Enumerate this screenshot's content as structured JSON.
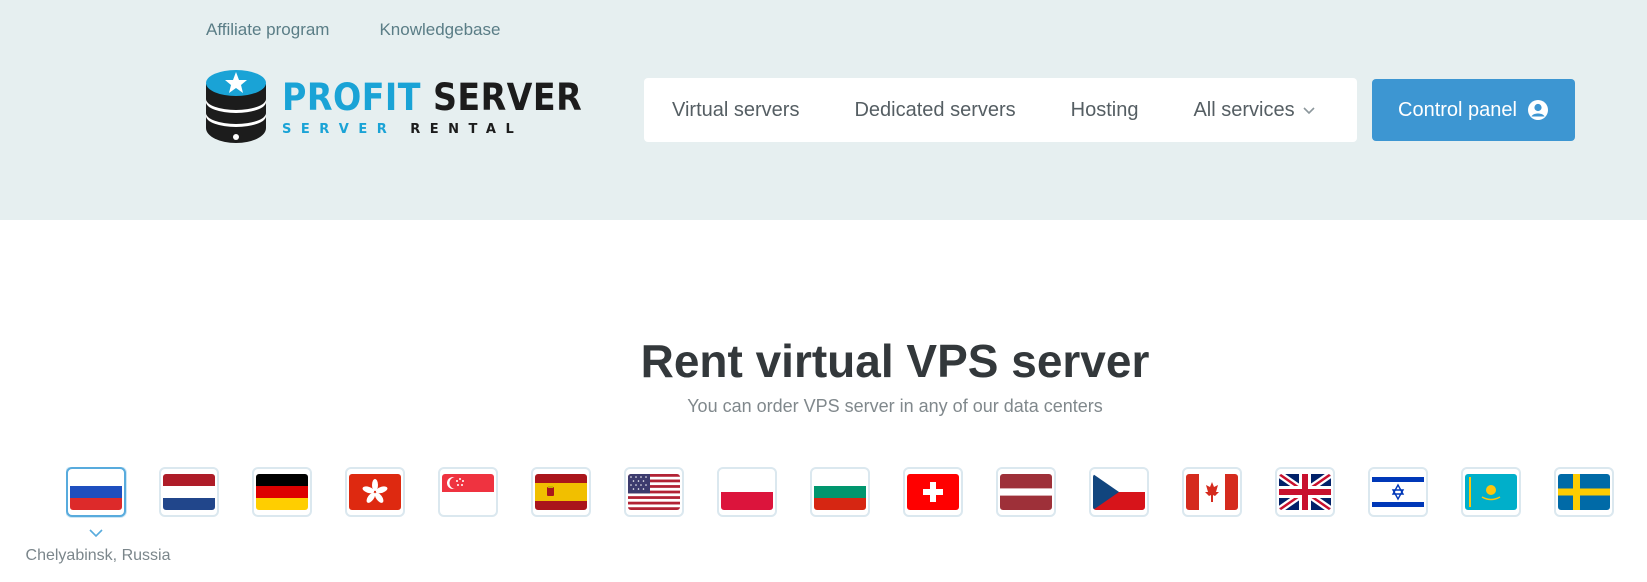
{
  "top_links": [
    "Affiliate program",
    "Knowledgebase"
  ],
  "logo": {
    "title_a": "PROFIT",
    "title_b": "SERVER",
    "sub_a": "SERVER",
    "sub_b": "RENTAL"
  },
  "nav": {
    "items": [
      "Virtual servers",
      "Dedicated servers",
      "Hosting",
      "All services"
    ],
    "control_panel": "Control panel"
  },
  "hero": {
    "title": "Rent virtual VPS server",
    "subtitle": "You can order VPS server in any of our data centers"
  },
  "locations": {
    "selected_label": "Chelyabinsk, Russia",
    "flags": [
      "russia-flag-icon",
      "netherlands-flag-icon",
      "germany-flag-icon",
      "hong-kong-flag-icon",
      "singapore-flag-icon",
      "spain-flag-icon",
      "usa-flag-icon",
      "poland-flag-icon",
      "bulgaria-flag-icon",
      "switzerland-flag-icon",
      "latvia-flag-icon",
      "czech-flag-icon",
      "canada-flag-icon",
      "uk-flag-icon",
      "israel-flag-icon",
      "kazakhstan-flag-icon",
      "sweden-flag-icon"
    ]
  },
  "colors": {
    "header_bg": "#e6eff0",
    "accent": "#3d96d2",
    "brand_blue": "#1aa3d6"
  }
}
